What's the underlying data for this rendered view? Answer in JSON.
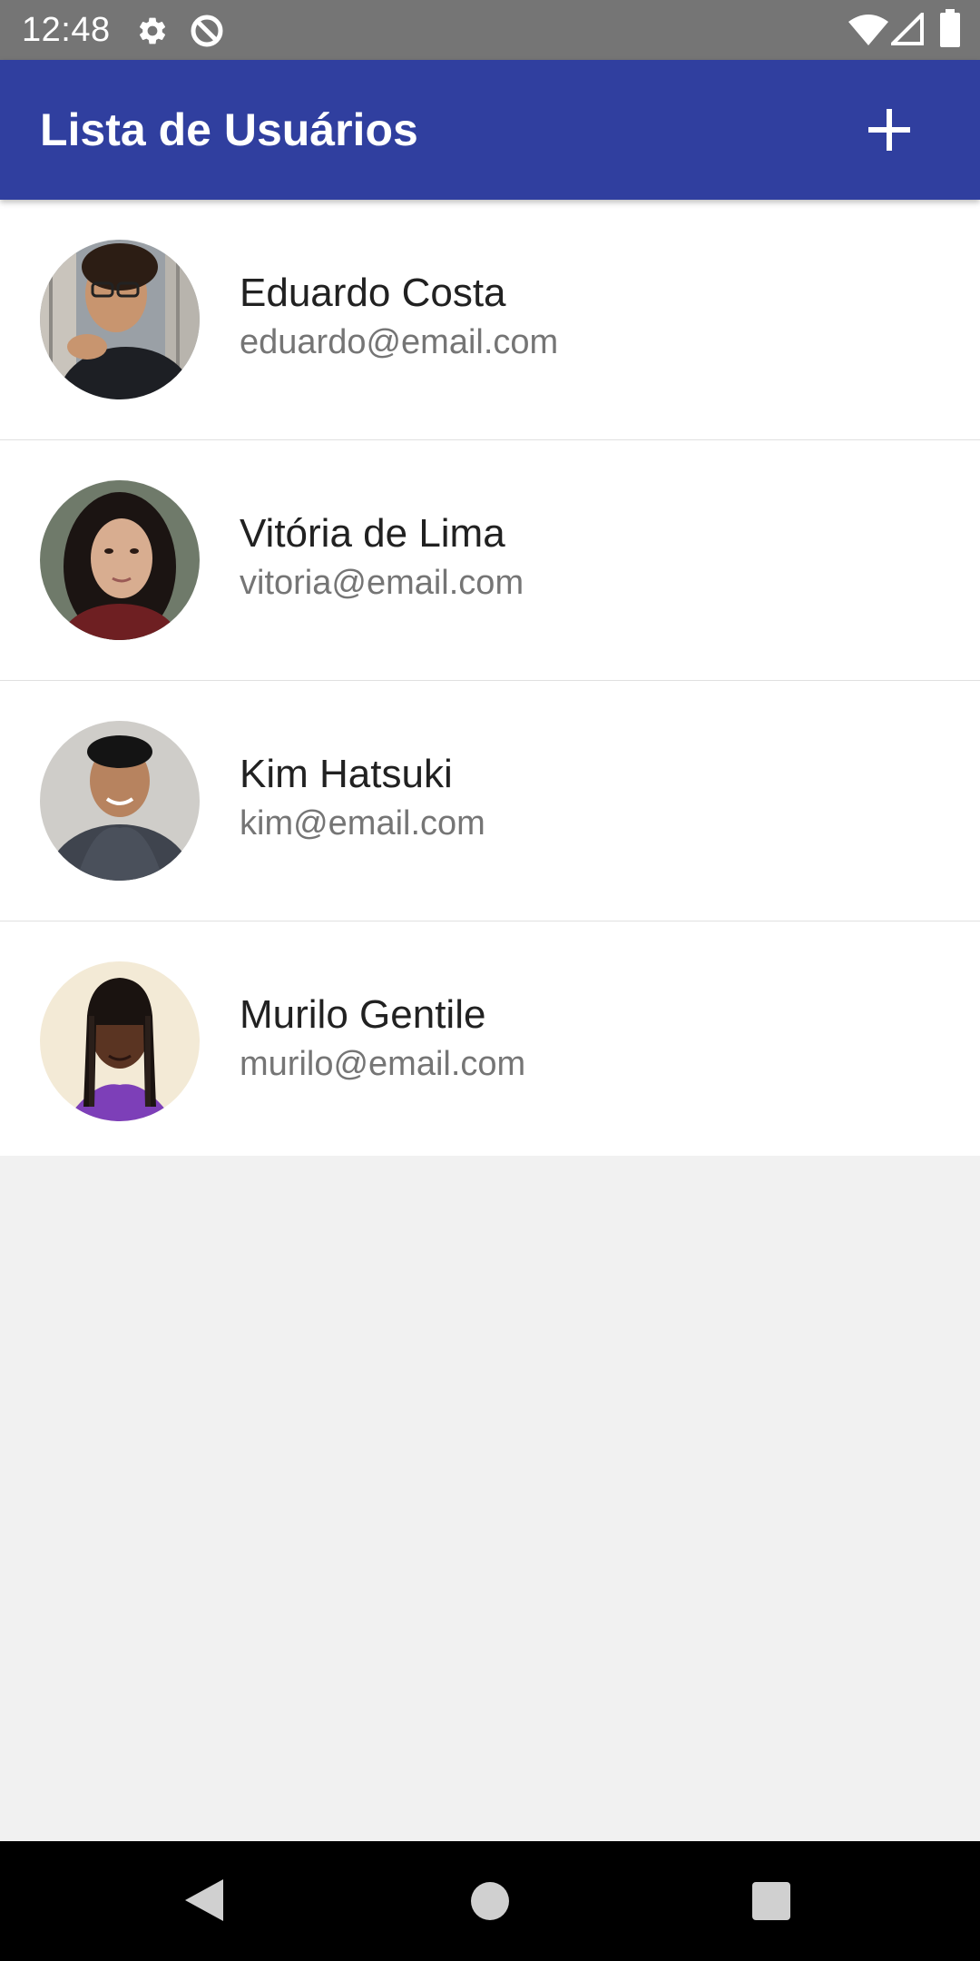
{
  "status_bar": {
    "time": "12:48",
    "icons": [
      "gear-icon",
      "data-saver-icon",
      "wifi-icon",
      "signal-icon",
      "battery-icon"
    ]
  },
  "app_bar": {
    "title": "Lista de Usuários",
    "add_icon": "plus-icon",
    "color": "#303f9f"
  },
  "users": [
    {
      "name": "Eduardo Costa",
      "email": "eduardo@email.com"
    },
    {
      "name": "Vitória de Lima",
      "email": "vitoria@email.com"
    },
    {
      "name": "Kim Hatsuki",
      "email": "kim@email.com"
    },
    {
      "name": "Murilo Gentile",
      "email": "murilo@email.com"
    }
  ],
  "nav_bar": {
    "icons": [
      "back-icon",
      "home-icon",
      "recents-icon"
    ]
  }
}
